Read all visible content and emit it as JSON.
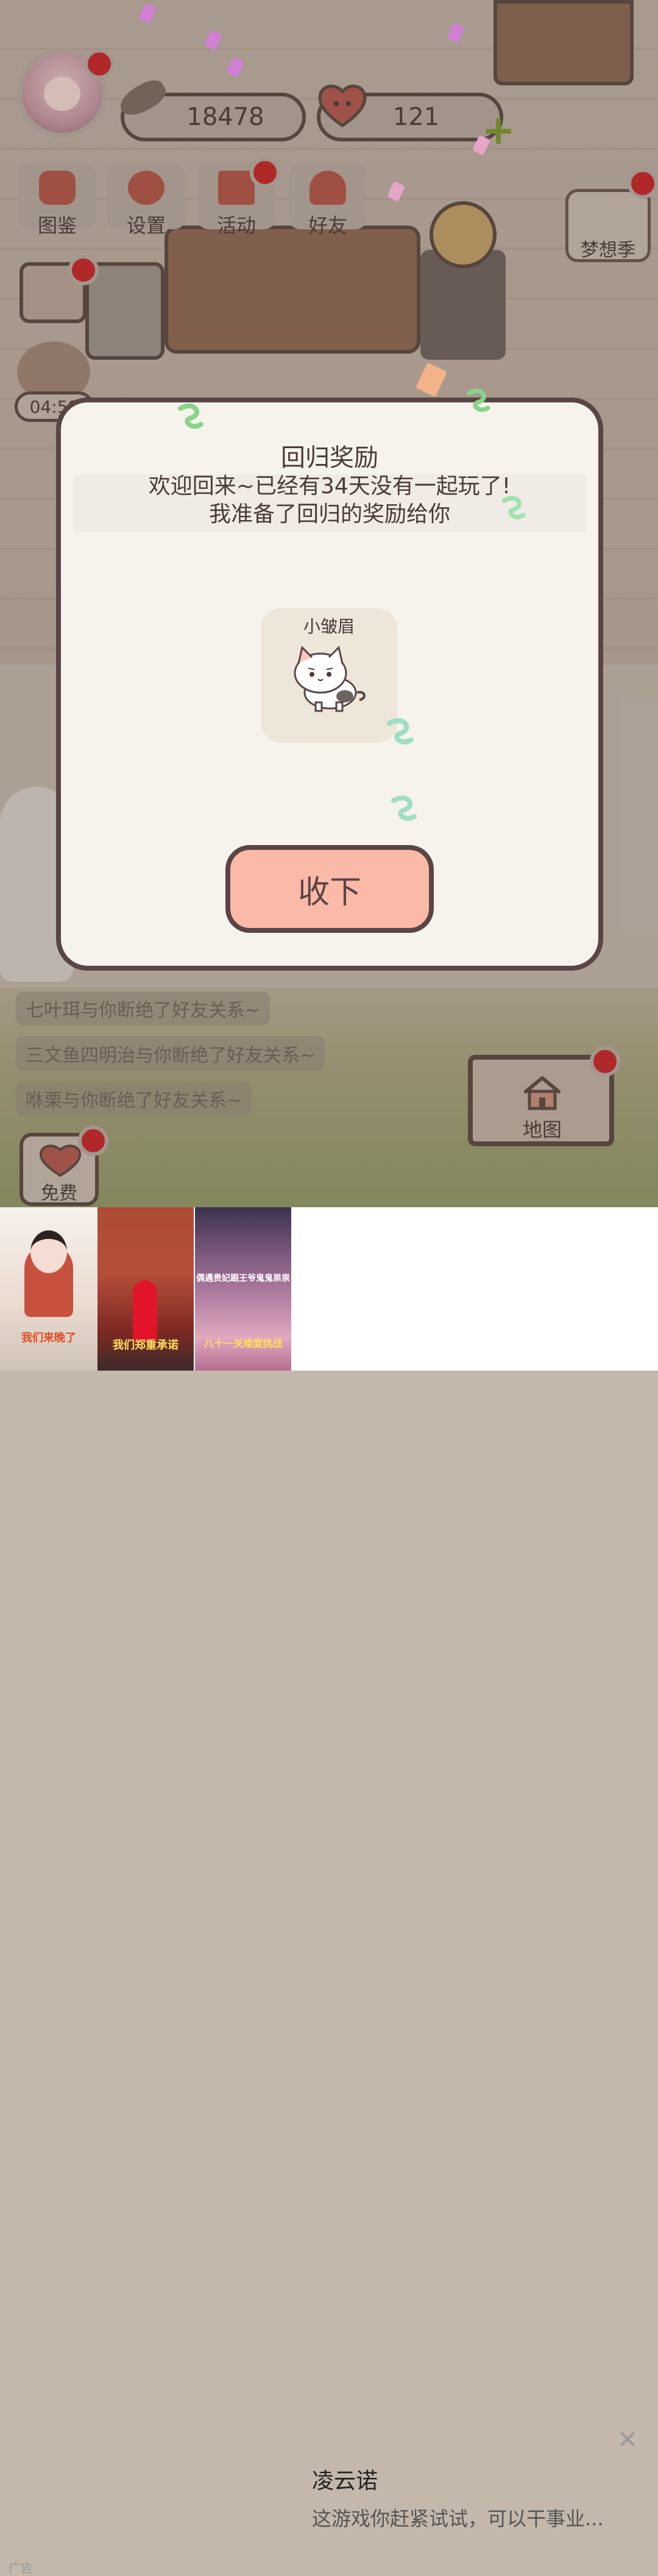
{
  "hud": {
    "fish_count": "18478",
    "heart_count": "121",
    "menu": [
      {
        "label": "图鉴",
        "icon": "cat-book-icon"
      },
      {
        "label": "设置",
        "icon": "gear-icon"
      },
      {
        "label": "活动",
        "icon": "gift-icon"
      },
      {
        "label": "好友",
        "icon": "friends-icon"
      }
    ],
    "season_label": "梦想季",
    "timer": "04:59"
  },
  "friend_messages": [
    "七叶珥与你断绝了好友关系~",
    "三文鱼四明治与你断绝了好友关系~",
    "咻栗与你断绝了好友关系~"
  ],
  "bottom_buttons": {
    "map_label": "地图",
    "free_label": "免费"
  },
  "dialog": {
    "title": "回归奖励",
    "message_line1": "欢迎回来~已经有34天没有一起玩了!",
    "message_line2": "我准备了回归的奖励给你",
    "reward_name": "小皱眉",
    "accept_label": "收下"
  },
  "ad": {
    "image1_caption": "我们来晚了",
    "image2_caption": "我们郑重承诺",
    "image3_caption": "八十一关难度挑战",
    "image3_top": "偶遇贵妃跟王爷鬼鬼祟祟",
    "title": "凌云诺",
    "description": "这游戏你赶紧试试，可以干事业...",
    "tag": "广告"
  },
  "colors": {
    "accent_red": "#c9262a",
    "button_pink": "#fbb9a8",
    "dialog_bg": "#f6f2ec",
    "outline": "#5a4545"
  }
}
